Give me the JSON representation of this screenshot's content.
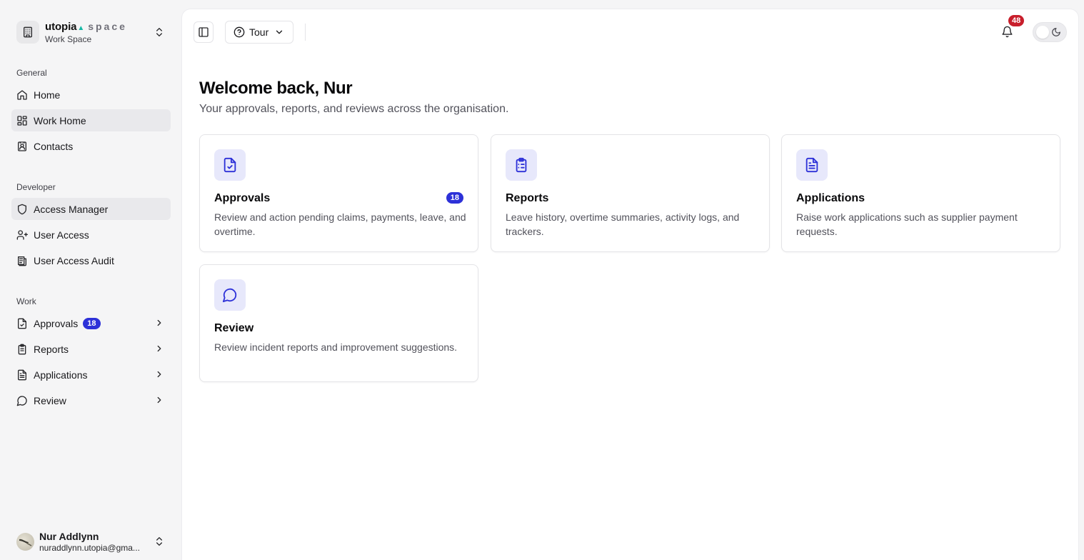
{
  "brand": {
    "name": "utopia",
    "suffix": "space",
    "workspace": "Work Space"
  },
  "sidebar": {
    "groups": {
      "general": "General",
      "developer": "Developer",
      "work": "Work"
    },
    "general_items": [
      {
        "label": "Home",
        "icon": "home-icon"
      },
      {
        "label": "Work Home",
        "icon": "layout-grid-icon",
        "active": true
      },
      {
        "label": "Contacts",
        "icon": "contact-book-icon"
      }
    ],
    "developer_items": [
      {
        "label": "Access Manager",
        "icon": "shield-icon",
        "active": true
      },
      {
        "label": "User Access",
        "icon": "user-plus-icon"
      },
      {
        "label": "User Access Audit",
        "icon": "audit-log-icon"
      }
    ],
    "work_items": [
      {
        "label": "Approvals",
        "icon": "file-check-icon",
        "badge": "18"
      },
      {
        "label": "Reports",
        "icon": "clipboard-list-icon"
      },
      {
        "label": "Applications",
        "icon": "file-text-icon"
      },
      {
        "label": "Review",
        "icon": "message-circle-icon"
      }
    ]
  },
  "user": {
    "name": "Nur Addlynn",
    "email": "nuraddlynn.utopia@gma..."
  },
  "header": {
    "tour_label": "Tour",
    "notification_count": "48"
  },
  "main": {
    "welcome": "Welcome back, Nur",
    "subtitle": "Your approvals, reports, and reviews across the organisation.",
    "cards": [
      {
        "title": "Approvals",
        "badge": "18",
        "description": "Review and action pending claims, payments, leave, and overtime.",
        "icon": "file-check-icon"
      },
      {
        "title": "Reports",
        "description": "Leave history, overtime summaries, activity logs, and trackers.",
        "icon": "clipboard-list-icon"
      },
      {
        "title": "Applications",
        "description": "Raise work applications such as supplier payment requests.",
        "icon": "file-text-icon"
      },
      {
        "title": "Review",
        "description": "Review incident reports and improvement suggestions.",
        "icon": "message-circle-icon"
      }
    ]
  },
  "colors": {
    "accent": "#2d31d8",
    "accent_bg": "#e7e8fb",
    "notification": "#c81e2b",
    "sidebar_bg": "#f5f5f6"
  }
}
